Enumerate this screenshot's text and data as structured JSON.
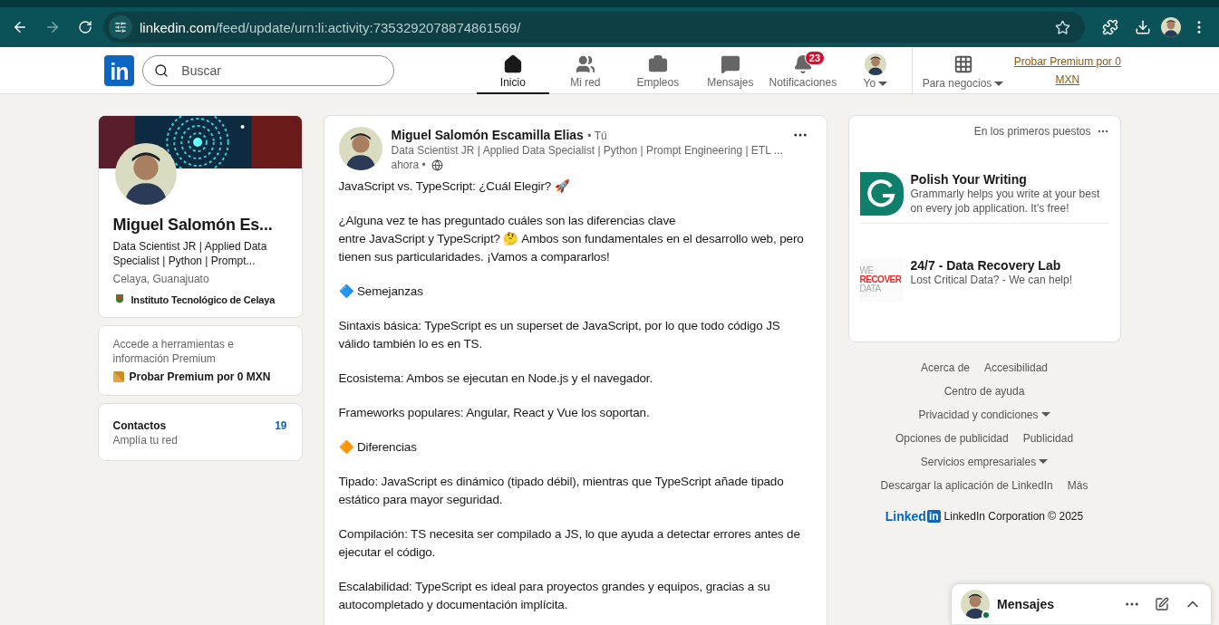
{
  "browser": {
    "url_host": "linkedin.com",
    "url_path": "/feed/update/urn:li:activity:7353292078874861569/"
  },
  "nav": {
    "logo": "in",
    "search": {
      "placeholder": "Buscar"
    },
    "items": [
      {
        "kind": "home",
        "label": "Inicio",
        "selected": true
      },
      {
        "kind": "network",
        "label": "Mi red",
        "selected": false
      },
      {
        "kind": "jobs",
        "label": "Empleos",
        "selected": false
      },
      {
        "kind": "messages",
        "label": "Mensajes",
        "selected": false
      },
      {
        "kind": "bell",
        "label": "Notificaciones",
        "selected": false,
        "badge": "23"
      },
      {
        "kind": "me",
        "label": "Yo",
        "selected": false,
        "dropdown": true
      }
    ],
    "business": "Para negocios",
    "premium": "Probar Premium por 0 MXN"
  },
  "profile": {
    "name": "Miguel Salomón Es...",
    "headline": "Data Scientist JR | Applied Data Specialist | Python | Prompt...",
    "location": "Celaya, Guanajuato",
    "school": "Instituto Tecnológico de Celaya"
  },
  "premium_card": {
    "text": "Accede a herramientas e información Premium",
    "link": "Probar Premium por 0 MXN"
  },
  "contacts": {
    "label": "Contactos",
    "sublabel": "Amplía tu red",
    "count": "19"
  },
  "post": {
    "author": "Miguel Salomón Escamilla Elias",
    "you": "• Tú",
    "headline": "Data Scientist JR | Applied Data Specialist | Python | Prompt Engineering | ETL ...",
    "time": "ahora •",
    "paragraphs": [
      "JavaScript vs. TypeScript: ¿Cuál Elegir? 🚀",
      "¿Alguna vez te has preguntado cuáles son las diferencias clave\nentre JavaScript y TypeScript? 🤔 Ambos son fundamentales en el desarrollo web, pero tienen sus particularidades. ¡Vamos a compararlos!",
      "🔷 Semejanzas",
      "Sintaxis básica: TypeScript es un superset de JavaScript, por lo que todo código JS válido también lo es en TS.",
      "Ecosistema: Ambos se ejecutan en Node.js y el navegador.",
      "Frameworks populares: Angular, React y Vue los soportan.",
      "🔶 Diferencias",
      "Tipado: JavaScript es dinámico (tipado débil), mientras que TypeScript añade tipado estático para mayor seguridad.",
      "Compilación: TS necesita ser compilado a JS, lo que ayuda a detectar errores antes de ejecutar el código.",
      "Escalabilidad: TypeScript es ideal para proyectos grandes y equipos, gracias a su autocompletado y documentación implícita."
    ]
  },
  "ads": {
    "header": "En los primeros puestos",
    "items": [
      {
        "kind": "grammarly",
        "title": "Polish Your Writing",
        "text": "Grammarly helps you write at your best on every job application. It's free!"
      },
      {
        "kind": "recover",
        "logo_lines": [
          "WE",
          "RECOVER",
          "DATA"
        ],
        "title": "24/7 - Data Recovery Lab",
        "text": "Lost Critical Data? - We can help!"
      }
    ]
  },
  "footer": {
    "rows": [
      [
        {
          "label": "Acerca de"
        },
        {
          "label": "Accesibilidad"
        }
      ],
      [
        {
          "label": "Centro de ayuda"
        }
      ],
      [
        {
          "label": "Privacidad y condiciones",
          "dropdown": true
        }
      ],
      [
        {
          "label": "Opciones de publicidad"
        },
        {
          "label": "Publicidad"
        }
      ],
      [
        {
          "label": "Servicios empresariales",
          "dropdown": true
        }
      ],
      [
        {
          "label": "Descargar la aplicación de LinkedIn"
        },
        {
          "label": "Más"
        }
      ]
    ],
    "logo_word": "Linked",
    "logo_box": "in",
    "copyright": "LinkedIn Corporation © 2025"
  },
  "messaging": {
    "title": "Mensajes",
    "online": true
  }
}
